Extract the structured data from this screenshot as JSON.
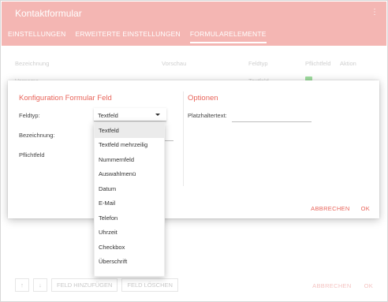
{
  "app": {
    "title": "Kontaktformular",
    "menu_glyph": "⋮"
  },
  "tabs": [
    {
      "label": "EINSTELLUNGEN",
      "active": false
    },
    {
      "label": "ERWEITERTE EINSTELLUNGEN",
      "active": false
    },
    {
      "label": "FORMULARELEMENTE",
      "active": true
    }
  ],
  "table": {
    "headers": [
      "Bezeichnung",
      "Vorschau",
      "Feldtyp",
      "Pflichtfeld",
      "Aktion"
    ],
    "rows": [
      {
        "bezeichnung": "Vorname",
        "vorschau": "",
        "feldtyp": "Textfeld",
        "pflichtfeld": true
      }
    ]
  },
  "toolbar": {
    "up_glyph": "↑",
    "down_glyph": "↓",
    "add_label": "FELD HINZUFÜGEN",
    "delete_label": "FELD LÖSCHEN",
    "cancel_label": "ABBRECHEN",
    "ok_label": "OK"
  },
  "dialog": {
    "title": "Konfiguration Formular Feld",
    "options_title": "Optionen",
    "feldtyp_label": "Feldtyp:",
    "feldtyp_value": "Textfeld",
    "bezeichnung_label": "Bezeichnung:",
    "bezeichnung_value": "",
    "pflichtfeld_label": "Pflichtfeld",
    "platzhalter_label": "Platzhaltertext:",
    "platzhalter_value": "",
    "cancel_label": "ABBRECHEN",
    "ok_label": "OK"
  },
  "dropdown": {
    "options": [
      "Textfeld",
      "Textfeld mehrzeilig",
      "Nummernfeld",
      "Auswahlmenü",
      "Datum",
      "E-Mail",
      "Telefon",
      "Uhrzeit",
      "Checkbox",
      "Überschrift"
    ],
    "selected_index": 0
  },
  "colors": {
    "header_bg": "#f4b6b3",
    "accent": "#e8645a",
    "check": "#9fdc9f"
  }
}
